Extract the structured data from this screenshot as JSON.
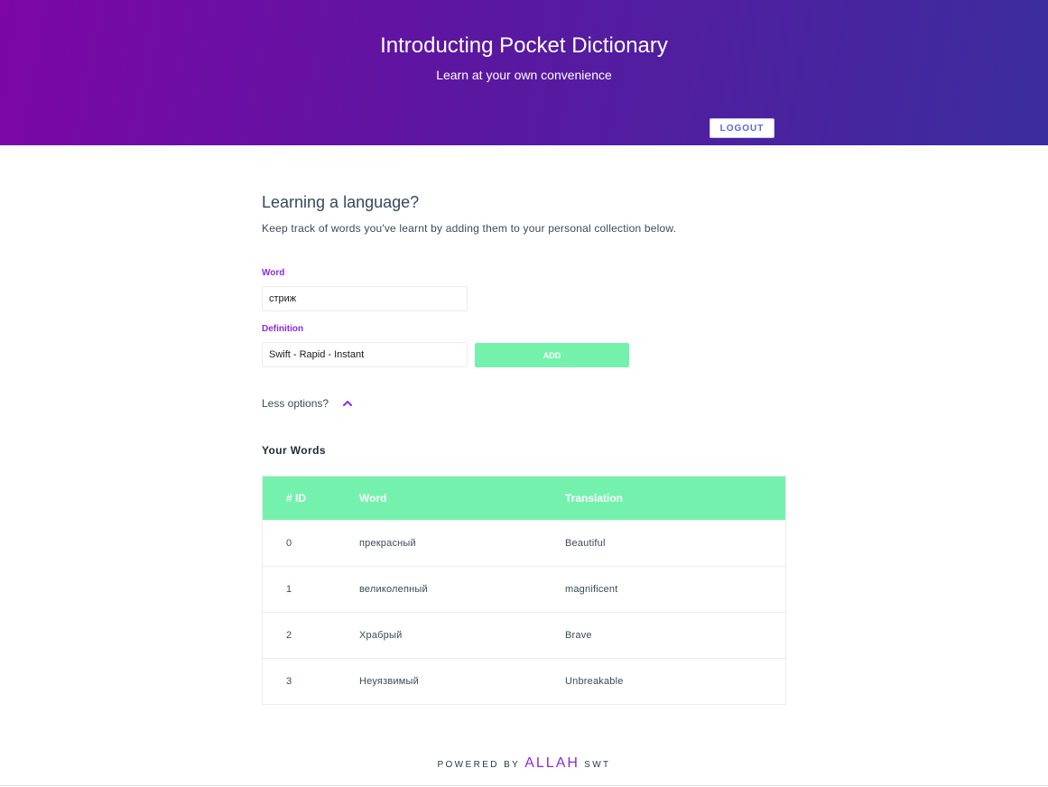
{
  "header": {
    "title": "Introducting Pocket Dictionary",
    "subtitle": "Learn at your own convenience",
    "logout_label": "LOGOUT"
  },
  "intro": {
    "heading": "Learning a language?",
    "description": "Keep track of words you've learnt by adding them to your personal collection below."
  },
  "form": {
    "word_label": "Word",
    "word_value": "стриж",
    "definition_label": "Definition",
    "definition_value": "Swift - Rapid - Instant",
    "add_label": "ADD"
  },
  "options": {
    "label": "Less options?",
    "icon": "chevron-up-icon"
  },
  "words": {
    "heading": "Your Words",
    "columns": [
      "# ID",
      "Word",
      "Translation"
    ],
    "rows": [
      {
        "id": "0",
        "word": "прекрасный",
        "translation": "Beautiful"
      },
      {
        "id": "1",
        "word": "великолепный",
        "translation": "magnificent"
      },
      {
        "id": "2",
        "word": "Храбрый",
        "translation": "Brave"
      },
      {
        "id": "3",
        "word": "Неуязвимый",
        "translation": "Unbreakable"
      }
    ]
  },
  "footer": {
    "prefix": "POWERED BY",
    "brand": "ALLAH",
    "suffix": "SWT"
  },
  "colors": {
    "accent": "#8a2be2",
    "table_header": "#74f2ad",
    "add_button": "#74f2ad",
    "hero_start": "#7c06a6",
    "hero_end": "#3b2d9e"
  }
}
